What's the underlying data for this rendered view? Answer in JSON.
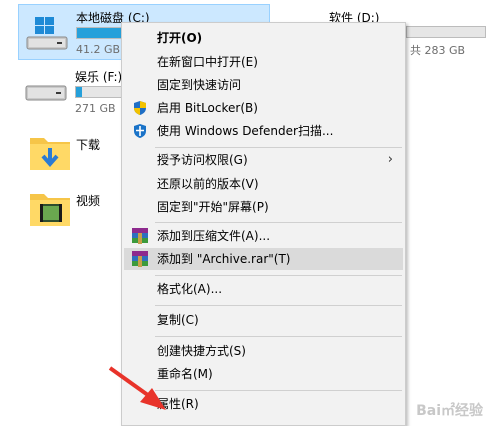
{
  "drives": {
    "c": {
      "name": "本地磁盘 (C:)",
      "free": "41.2 GB",
      "used_fraction": 0.6
    },
    "d": {
      "name": "软件 (D:)",
      "total_suffix": "共 283 GB"
    },
    "f": {
      "name": "娱乐 (F:)",
      "free": "271 GB",
      "used_fraction": 0.12
    }
  },
  "folders": [
    {
      "name": "下载",
      "icon": "download-folder-icon"
    },
    {
      "name": "视频",
      "icon": "video-folder-icon"
    }
  ],
  "menu": {
    "items": [
      {
        "label": "打开(O)",
        "bold": true
      },
      {
        "label": "在新窗口中打开(E)"
      },
      {
        "label": "固定到快速访问"
      },
      {
        "label": "启用 BitLocker(B)",
        "icon": "shield-icon"
      },
      {
        "label": "使用 Windows Defender扫描...",
        "icon": "defender-icon"
      },
      {
        "label": "授予访问权限(G)",
        "submenu": true
      },
      {
        "label": "还原以前的版本(V)"
      },
      {
        "label": "固定到\"开始\"屏幕(P)"
      },
      {
        "label": "添加到压缩文件(A)...",
        "icon": "winrar-icon"
      },
      {
        "label": "添加到 \"Archive.rar\"(T)",
        "icon": "winrar-icon",
        "highlighted": true
      },
      {
        "label": "格式化(A)..."
      },
      {
        "label": "复制(C)"
      },
      {
        "label": "创建快捷方式(S)"
      },
      {
        "label": "重命名(M)"
      },
      {
        "label": "属性(R)"
      }
    ],
    "submenu_arrow": "›"
  },
  "watermark": "Bai㎡经验",
  "colors": {
    "selection": "#cce8ff",
    "bar_fill": "#26a0da",
    "arrow": "#e8332a"
  }
}
